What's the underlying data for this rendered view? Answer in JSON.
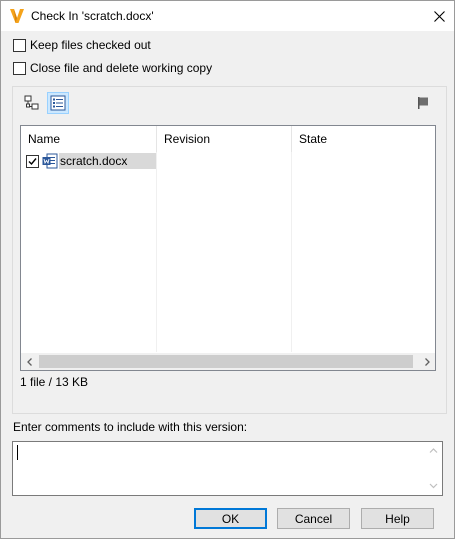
{
  "window": {
    "title": "Check In 'scratch.docx'"
  },
  "options": {
    "keep_checked_out": {
      "label": "Keep files checked out",
      "checked": false
    },
    "close_delete": {
      "label": "Close file and delete working copy",
      "checked": false
    }
  },
  "toolbar": {
    "tree_view_icon": "tree-view-icon",
    "list_view_icon": "list-view-icon",
    "flag_icon": "flag-icon"
  },
  "filelist": {
    "columns": [
      "Name",
      "Revision",
      "State"
    ],
    "rows": [
      {
        "name": "scratch.docx",
        "revision": "",
        "state": "",
        "checked": true
      }
    ]
  },
  "summary": "1 file / 13 KB",
  "comments": {
    "label": "Enter comments to include with this version:",
    "value": ""
  },
  "buttons": {
    "ok": "OK",
    "cancel": "Cancel",
    "help": "Help"
  },
  "colors": {
    "accent": "#0078d7",
    "selection": "#cce8ff",
    "vault_brand": "#f5a31a",
    "word_blue": "#2b579a"
  }
}
